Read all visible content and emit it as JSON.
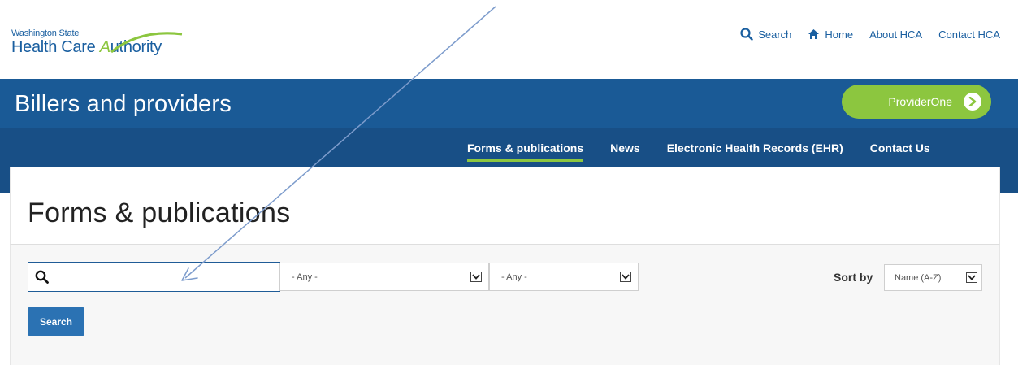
{
  "header": {
    "logo_small": "Washington State",
    "logo_big_prefix": "Health Care ",
    "logo_big_suffix": "uthority",
    "utility_nav": [
      {
        "label": "Search",
        "icon": "search-icon"
      },
      {
        "label": "Home",
        "icon": "home-icon"
      },
      {
        "label": "About HCA"
      },
      {
        "label": "Contact HCA"
      }
    ]
  },
  "banner": {
    "title": "Billers and providers",
    "providerone_label": "ProviderOne",
    "providerone_icon": "chevron-right-circle-icon"
  },
  "main_nav": [
    {
      "label": "Forms & publications",
      "active": true
    },
    {
      "label": "News"
    },
    {
      "label": "Electronic Health Records (EHR)"
    },
    {
      "label": "Contact Us"
    }
  ],
  "page": {
    "title": "Forms & publications"
  },
  "filters": {
    "search_value": "",
    "search_icon": "search-icon",
    "select1_value": "- Any -",
    "select2_value": "- Any -",
    "sort_label": "Sort by",
    "sort_value": "Name (A-Z)",
    "search_button": "Search"
  },
  "colors": {
    "brand_blue": "#1a5a96",
    "nav_blue": "#184f86",
    "accent_green": "#8cc63f",
    "button_blue": "#2b72b3",
    "annotation_arrow": "#7d9ccc"
  }
}
